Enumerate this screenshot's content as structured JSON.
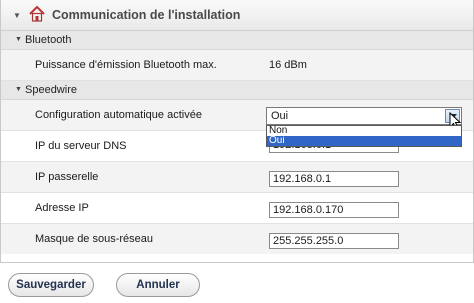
{
  "header": {
    "title": "Communication de l'installation"
  },
  "sections": {
    "bluetooth": {
      "label": "Bluetooth"
    },
    "speedwire": {
      "label": "Speedwire"
    }
  },
  "rows": {
    "bt_power": {
      "label": "Puissance d'émission Bluetooth max.",
      "value": "16  dBm"
    },
    "auto_config": {
      "label": "Configuration automatique activée",
      "selected": "Oui",
      "options": [
        "Non",
        "Oui"
      ]
    },
    "dns_ip": {
      "label": "IP du serveur DNS",
      "value": "192.168.0.1"
    },
    "gateway_ip": {
      "label": "IP passerelle",
      "value": "192.168.0.1"
    },
    "ip_address": {
      "label": "Adresse IP",
      "value": "192.168.0.170"
    },
    "subnet_mask": {
      "label": "Masque de sous-réseau",
      "value": "255.255.255.0"
    }
  },
  "buttons": {
    "save": "Sauvegarder",
    "cancel": "Annuler"
  },
  "colors": {
    "highlight": "#3166c6",
    "header_text": "#4a4a4a",
    "button_text": "#22324f"
  }
}
